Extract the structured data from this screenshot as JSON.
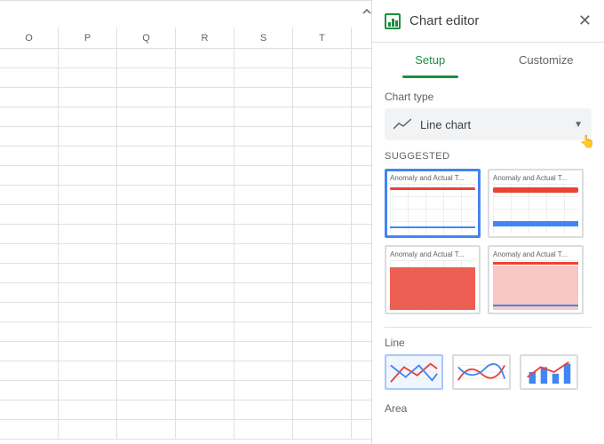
{
  "sheet": {
    "columns": [
      "O",
      "P",
      "Q",
      "R",
      "S",
      "T"
    ]
  },
  "editor": {
    "title": "Chart editor",
    "tabs": {
      "setup": "Setup",
      "customize": "Customize"
    },
    "chart_type_label": "Chart type",
    "chart_type_value": "Line chart",
    "suggested_label": "SUGGESTED",
    "suggested": [
      {
        "title": "Anomaly and Actual T..."
      },
      {
        "title": "Anomaly and Actual T..."
      },
      {
        "title": "Anomaly and Actual T..."
      },
      {
        "title": "Anomaly and Actual T..."
      }
    ],
    "line_label": "Line",
    "area_label": "Area"
  }
}
